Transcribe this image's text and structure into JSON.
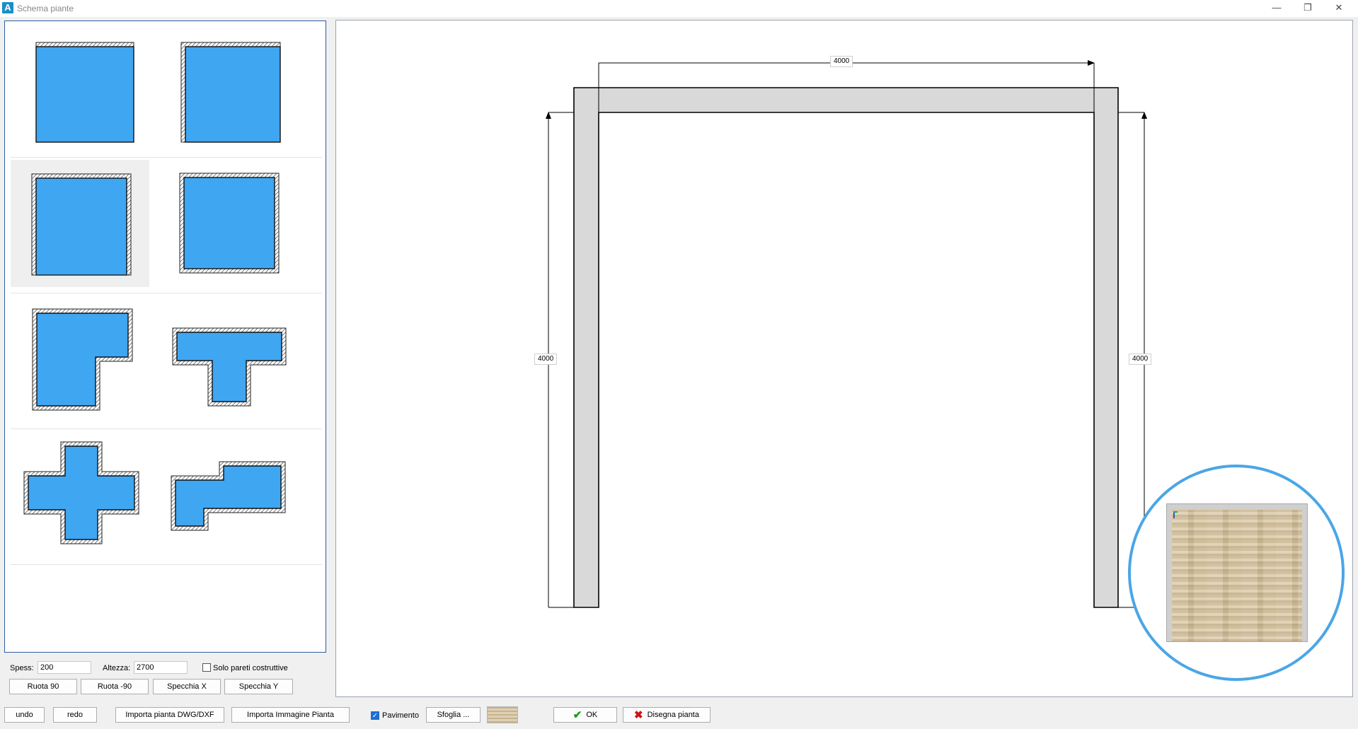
{
  "window": {
    "title": "Schema piante",
    "app_icon_letter": "A",
    "controls": {
      "minimize": "—",
      "maximize": "❐",
      "close": "✕"
    }
  },
  "options": {
    "thickness_label": "Spess:",
    "thickness_value": "200",
    "height_label": "Altezza:",
    "height_value": "2700",
    "only_structural_label": "Solo pareti costruttive",
    "only_structural_checked": false,
    "rotate90": "Ruota 90",
    "rotate_minus90": "Ruota -90",
    "mirror_x": "Specchia X",
    "mirror_y": "Specchia Y"
  },
  "toolbar": {
    "undo": "undo",
    "redo": "redo",
    "import_dwg": "Importa pianta DWG/DXF",
    "import_image": "Importa Immagine Pianta",
    "floor_label": "Pavimento",
    "floor_checked": true,
    "browse": "Sfoglia ...",
    "ok": "OK",
    "draw": "Disegna pianta"
  },
  "drawing": {
    "dim_top": "4000",
    "dim_left": "4000",
    "dim_right": "4000"
  },
  "colors": {
    "shape_fill": "#3fa6f2",
    "wall_fill": "#d9d9d9",
    "selection_ring": "#4aa6e6",
    "panel_border": "#2d5d9f"
  }
}
